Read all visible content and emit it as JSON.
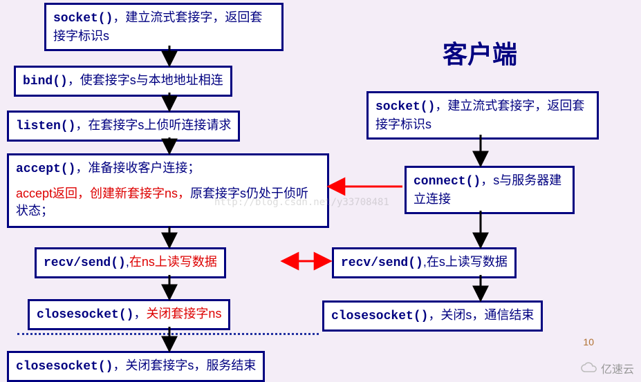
{
  "title_client": "客户端",
  "server": {
    "socket": {
      "fn": "socket()",
      "desc": "，建立流式套接字，返回套接字标识s"
    },
    "bind": {
      "fn": "bind()",
      "desc": "，使套接字s与本地地址相连"
    },
    "listen": {
      "fn": "listen()",
      "desc": "，在套接字s上侦听连接请求"
    },
    "accept_top": {
      "fn": "accept()",
      "desc": "，准备接收客户连接；"
    },
    "accept_bot": {
      "text": "accept返回，创建新套接字ns，",
      "tail": "原套接字s仍处于侦听状态；"
    },
    "rw": {
      "fn": "recv/send()",
      "desc": ",",
      "red": "在ns上读写数据"
    },
    "close_ns": {
      "fn": "closesocket()",
      "desc": "，",
      "red": "关闭套接字ns"
    },
    "close_s": {
      "fn": "closesocket()",
      "desc": "，关闭套接字s，服务结束"
    }
  },
  "client": {
    "socket": {
      "fn": "socket()",
      "desc": "，建立流式套接字，返回套接字标识s"
    },
    "connect": {
      "fn": "connect()",
      "desc": "，s与服务器建立连接"
    },
    "rw": {
      "fn": "recv/send()",
      "desc": ",在s上读写数据"
    },
    "close": {
      "fn": "closesocket()",
      "desc": "，关闭s，通信结束"
    }
  },
  "watermark": "http://blog.csdn.net/y33708481",
  "page_number": "10",
  "logo_text": "亿速云",
  "colors": {
    "border": "#000080",
    "accent": "#d00000",
    "arrow_red": "#ff0000",
    "arrow_blk": "#000000"
  }
}
